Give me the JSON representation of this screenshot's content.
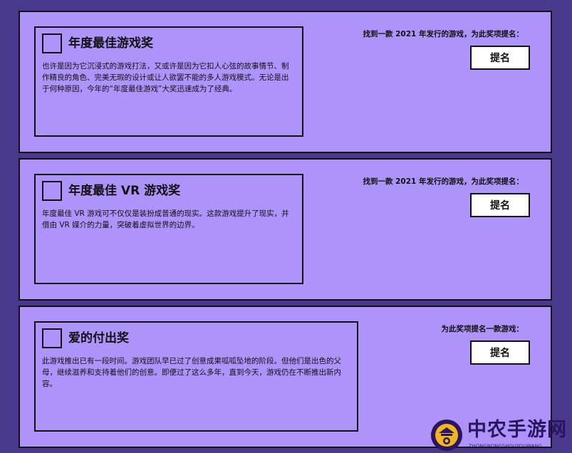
{
  "awards": [
    {
      "title": "年度最佳游戏奖",
      "description": "也许是因为它沉浸式的游戏打法，又或许是因为它扣人心弦的故事情节、制作精良的角色、完美无瑕的设计或让人欲罢不能的多人游戏模式。无论是出于何种原因，今年的“年度最佳游戏”大奖迅速成为了经典。",
      "prompt": "找到一款 2021 年发行的游戏，为此奖项提名：",
      "button_label": "提名"
    },
    {
      "title": "年度最佳 VR 游戏奖",
      "description": "年度最佳 VR 游戏可不仅仅是装扮成普通的现实。这款游戏提升了现实，并借由 VR 媒介的力量，突破着虚拟世界的边界。",
      "prompt": "找到一款 2021 年发行的游戏，为此奖项提名：",
      "button_label": "提名"
    },
    {
      "title": "爱的付出奖",
      "description": "此游戏推出已有一段时间。游戏团队早已过了创意成果呱呱坠地的阶段。但他们是出色的父母，继续滋养和支持着他们的创意。即便过了这么多年，直到今天，游戏仍在不断推出新内容。",
      "prompt": "为此奖项提名一款游戏：",
      "button_label": "提名"
    }
  ],
  "watermark": {
    "text": "中农手游网",
    "subtext": "ZHONGNONGSHOUYOUWANG",
    "icon": "brand-logo-icon"
  },
  "colors": {
    "page_background": "#49388c",
    "panel_background": "#ae93fb",
    "border": "#111111",
    "button_background": "#ffffff"
  }
}
